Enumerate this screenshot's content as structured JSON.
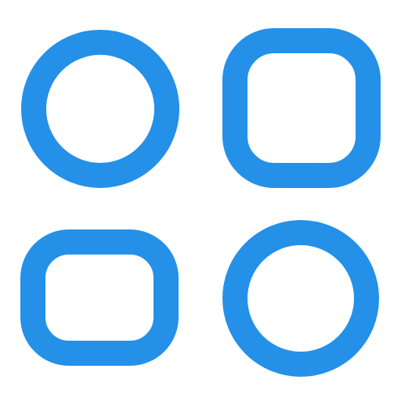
{
  "icon": {
    "name": "apps-grid-icon",
    "color": "#2490E8",
    "background": "#FFFFFF",
    "shapes": [
      {
        "name": "circle-shape-top-left",
        "kind": "circle"
      },
      {
        "name": "rounded-square-shape-top-right",
        "kind": "rounded-square"
      },
      {
        "name": "rounded-square-shape-bottom-left",
        "kind": "rounded-square"
      },
      {
        "name": "circle-shape-bottom-right",
        "kind": "circle"
      }
    ]
  }
}
